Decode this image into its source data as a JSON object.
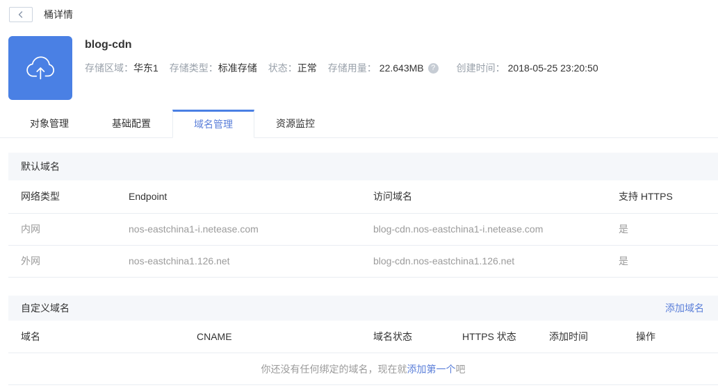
{
  "topbar": {
    "title": "桶详情"
  },
  "bucket": {
    "name": "blog-cdn",
    "meta": [
      {
        "label": "存储区域：",
        "value": "华东1"
      },
      {
        "label": "存储类型：",
        "value": "标准存储"
      },
      {
        "label": "状态：",
        "value": "正常"
      },
      {
        "label": "存储用量：",
        "value": "22.643MB"
      },
      {
        "label": "创建时间：",
        "value": "2018-05-25 23:20:50"
      }
    ],
    "help_icon_glyph": "?"
  },
  "tabs": [
    {
      "label": "对象管理",
      "active": false
    },
    {
      "label": "基础配置",
      "active": false
    },
    {
      "label": "域名管理",
      "active": true
    },
    {
      "label": "资源监控",
      "active": false
    }
  ],
  "default_domain": {
    "title": "默认域名",
    "columns": [
      "网络类型",
      "Endpoint",
      "访问域名",
      "支持 HTTPS"
    ],
    "rows": [
      {
        "type": "内网",
        "endpoint": "nos-eastchina1-i.netease.com",
        "domain": "blog-cdn.nos-eastchina1-i.netease.com",
        "https": "是"
      },
      {
        "type": "外网",
        "endpoint": "nos-eastchina1.126.net",
        "domain": "blog-cdn.nos-eastchina1.126.net",
        "https": "是"
      }
    ]
  },
  "custom_domain": {
    "title": "自定义域名",
    "add_link": "添加域名",
    "columns": [
      "域名",
      "CNAME",
      "域名状态",
      "HTTPS 状态",
      "添加时间",
      "操作"
    ],
    "empty": {
      "prefix": "你还没有任何绑定的域名，现在就",
      "link": "添加第一个",
      "suffix": "吧"
    }
  },
  "colors": {
    "accent": "#4a80e4",
    "link": "#5b7fd9"
  }
}
